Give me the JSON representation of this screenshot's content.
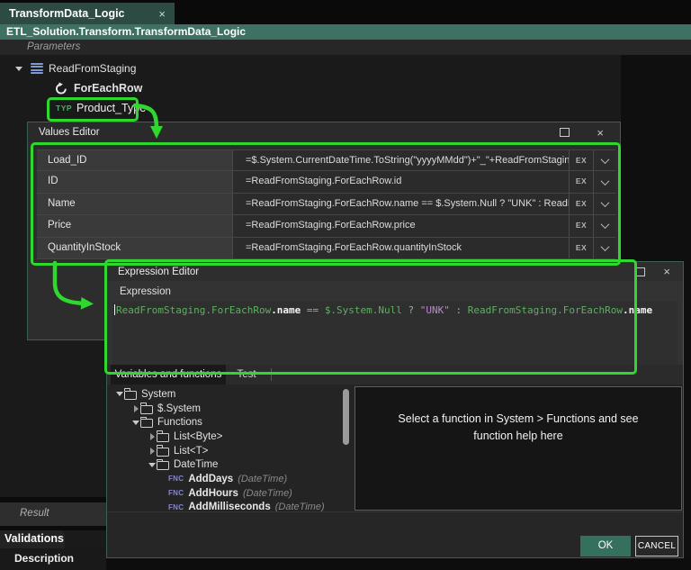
{
  "window": {
    "tab_title": "TransformData_Logic",
    "tab_close": "×",
    "breadcrumb": "ETL_Solution.Transform.TransformData_Logic",
    "parameters_label": "Parameters"
  },
  "parameter_tree": {
    "read_from_staging": "ReadFromStaging",
    "for_each_row": "ForEachRow",
    "product_type_badge": "TYP",
    "product_type_label": "Product_Type"
  },
  "values_editor": {
    "title": "Values Editor",
    "close": "×",
    "ex_button": "EX",
    "rows": [
      {
        "name": "Load_ID",
        "expression": "=$.System.CurrentDateTime.ToString(\"yyyyMMdd\")+\"_\"+ReadFromStaging.ForEachRow.id"
      },
      {
        "name": "ID",
        "expression": "=ReadFromStaging.ForEachRow.id"
      },
      {
        "name": "Name",
        "expression": "=ReadFromStaging.ForEachRow.name == $.System.Null ? \"UNK\" : ReadFromStaging.ForEachRow.name"
      },
      {
        "name": "Price",
        "expression": "=ReadFromStaging.ForEachRow.price"
      },
      {
        "name": "QuantityInStock",
        "expression": "=ReadFromStaging.ForEachRow.quantityInStock"
      }
    ]
  },
  "expression_editor": {
    "title": "Expression Editor",
    "close": "×",
    "expression_label": "Expression",
    "code_tokens": [
      {
        "t": "ReadFromStaging.ForEachRow",
        "c": "ident"
      },
      {
        "t": ".name",
        "c": "member"
      },
      {
        "t": " == ",
        "c": "op"
      },
      {
        "t": "$.System.Null",
        "c": "ident"
      },
      {
        "t": " ? ",
        "c": "op"
      },
      {
        "t": "\"UNK\"",
        "c": "string"
      },
      {
        "t": " : ",
        "c": "op"
      },
      {
        "t": "ReadFromStaging.ForEachRow",
        "c": "ident"
      },
      {
        "t": ".name",
        "c": "member"
      }
    ],
    "tabs": {
      "variables": "Variables and functions",
      "test": "Test"
    },
    "function_tree": [
      {
        "label": "System",
        "type": "folder",
        "expanded": true,
        "level": 0
      },
      {
        "label": "$.System",
        "type": "folder",
        "expanded": false,
        "level": 1
      },
      {
        "label": "Functions",
        "type": "folder",
        "expanded": true,
        "level": 1
      },
      {
        "label": "List<Byte>",
        "type": "folder",
        "expanded": false,
        "level": 2
      },
      {
        "label": "List<T>",
        "type": "folder",
        "expanded": false,
        "level": 2
      },
      {
        "label": "DateTime",
        "type": "folder",
        "expanded": true,
        "level": 2
      },
      {
        "label": "AddDays",
        "type": "function",
        "badge": "FNC",
        "suffix": "(DateTime)",
        "level": 3
      },
      {
        "label": "AddHours",
        "type": "function",
        "badge": "FNC",
        "suffix": "(DateTime)",
        "level": 3
      },
      {
        "label": "AddMilliseconds",
        "type": "function",
        "badge": "FNC",
        "suffix": "(DateTime)",
        "level": 3
      }
    ],
    "help_text": "Select a function in System > Functions and see function help here",
    "ok_label": "OK",
    "cancel_label": "CANCEL"
  },
  "bottom_panels": {
    "result": "Result",
    "validations": "Validations",
    "description": "Description"
  },
  "colors": {
    "highlight_green": "#2fd82f",
    "tab_teal": "#2c4b42",
    "breadcrumb_teal": "#3e7163",
    "dialog_border_teal": "#3c6154",
    "ok_button": "#35705f",
    "code_identifier": "#5fae63",
    "code_string": "#bb86cf",
    "fnc_badge": "#8585d8",
    "db_icon_blue": "#7d9bd1",
    "typ_badge_green": "#4caf63"
  }
}
